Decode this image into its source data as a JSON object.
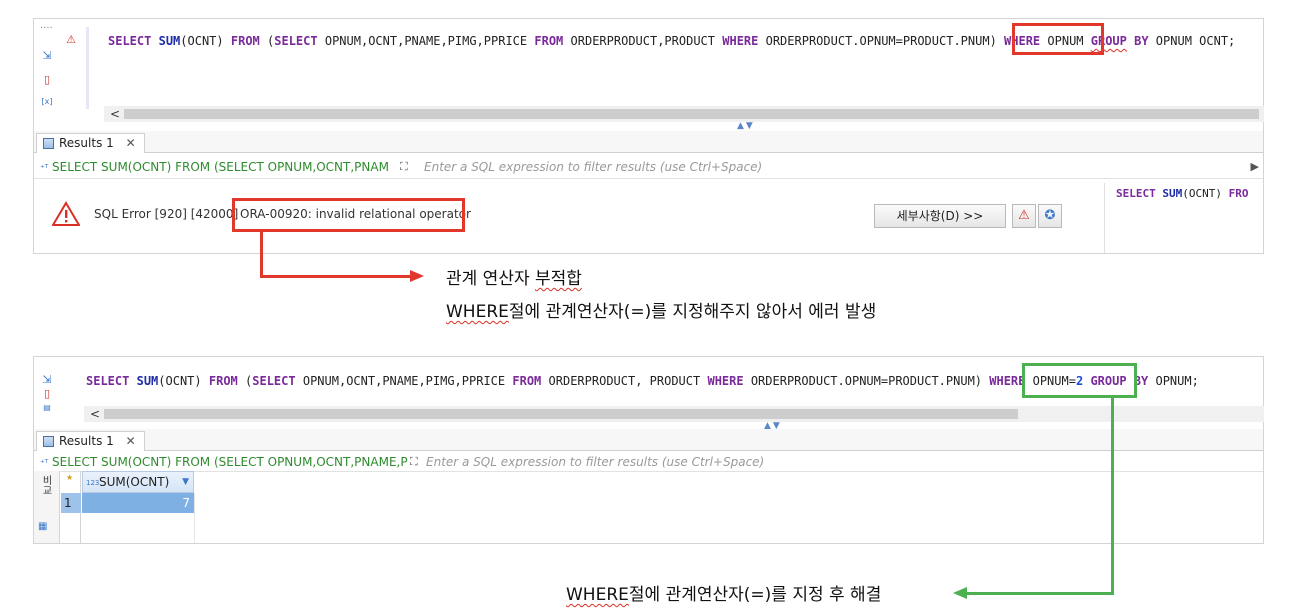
{
  "panel1": {
    "sql": {
      "kw_select": "SELECT",
      "fn_sum": "SUM",
      "p1": "(OCNT)",
      "kw_from": "FROM",
      "p2": "(",
      "kw_select2": "SELECT",
      "p3": "OPNUM,OCNT,PNAME,PIMG,PPRICE",
      "kw_from2": "FROM",
      "p4": "ORDERPRODUCT,PRODUCT",
      "kw_where": "WHERE",
      "p5": "ORDERPRODUCT.OPNUM=PRODUCT.PNUM)",
      "kw_where2": "WHERE",
      "p6": "OPNUM",
      "kw_group": "GROUP",
      "kw_by": "BY",
      "p7": "OPNUM OCNT;"
    },
    "tab_label": "Results 1",
    "tab_close": "✕",
    "filter_query": "SELECT SUM(OCNT) FROM (SELECT OPNUM,OCNT,PNAM",
    "filter_placeholder": "Enter a SQL expression to filter results (use Ctrl+Space)",
    "error_code": "SQL Error [920] [42000]",
    "error_message": "ORA-00920: invalid relational operator",
    "details_button": "세부사항(D) >>",
    "side_sql_kw1": "SELECT",
    "side_sql_fn": "SUM",
    "side_sql_rest": "(OCNT)",
    "side_sql_kw2": "FRO"
  },
  "panel2": {
    "sql": {
      "kw_select": "SELECT",
      "fn_sum": "SUM",
      "p1": "(OCNT)",
      "kw_from": "FROM",
      "p2": "(",
      "kw_select2": "SELECT",
      "p3": "OPNUM,OCNT,PNAME,PIMG,PPRICE",
      "kw_from2": "FROM",
      "p4": "ORDERPRODUCT, PRODUCT",
      "kw_where": "WHERE",
      "p5": "ORDERPRODUCT.OPNUM=PRODUCT.PNUM)",
      "kw_where2": "WHERE",
      "p6": "OPNUM=",
      "num2": "2",
      "kw_group": "GROUP",
      "kw_by": "BY",
      "p7": "OPNUM;"
    },
    "tab_label": "Results 1",
    "tab_close": "✕",
    "filter_query": "SELECT SUM(OCNT) FROM (SELECT OPNUM,OCNT,PNAME,PIN",
    "filter_placeholder": "Enter a SQL expression to filter results (use Ctrl+Space)",
    "side_tab": "비교",
    "column_type": "123",
    "column_header": "SUM(OCNT)",
    "row_number": "1",
    "cell_value": "7"
  },
  "annotations": {
    "error_line1_a": "관계 연산자",
    "error_line1_b": "부적합",
    "error_line2_a": "WHERE",
    "error_line2_b": "절에 관계연산자(=)를 지정해주지 않아서 에러 발생",
    "fix_line_a": "WHERE",
    "fix_line_b": "절에 관계연산자(=)를 지정 후 해결"
  },
  "colors": {
    "error_highlight": "#e2372b",
    "fix_highlight": "#4caf50",
    "keyword": "#7a2a9a"
  }
}
